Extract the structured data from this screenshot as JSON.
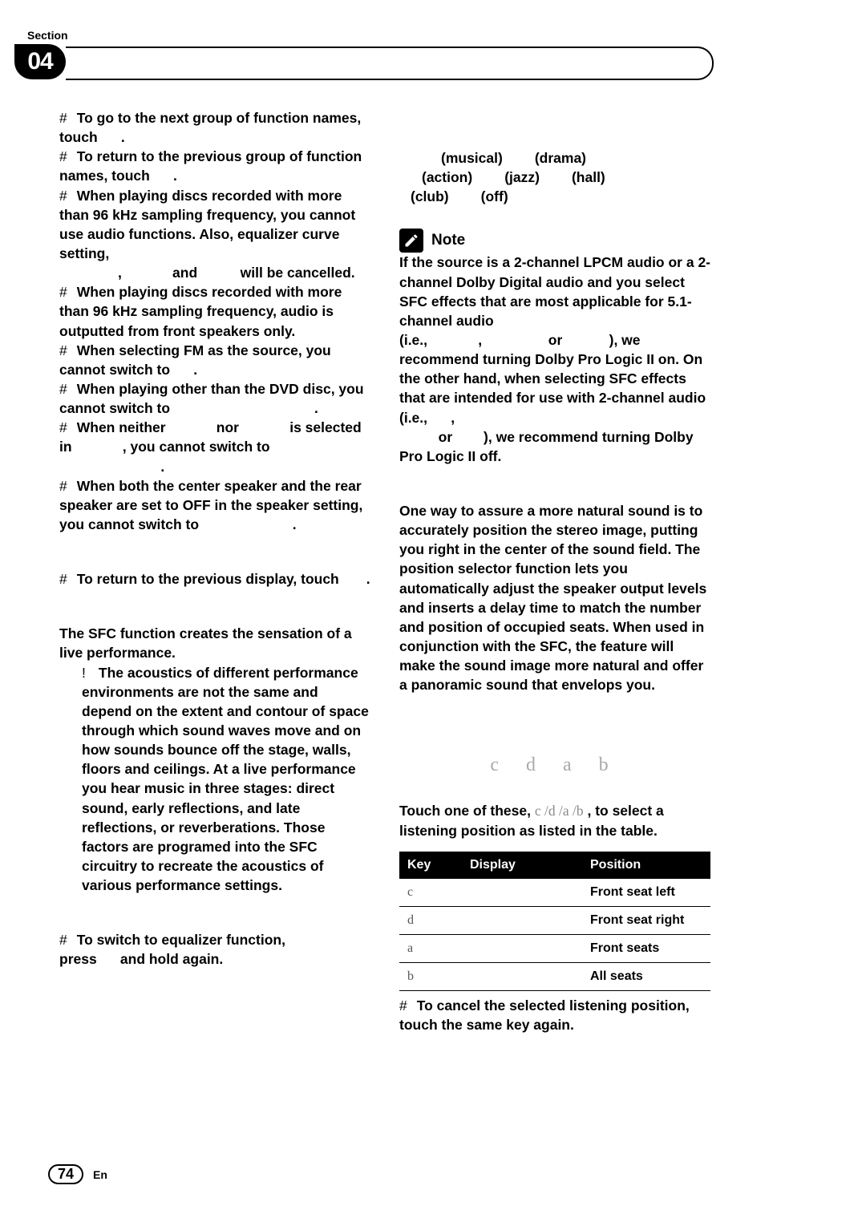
{
  "header": {
    "section_label": "Section",
    "section_number": "04"
  },
  "left": {
    "l1": "To go to the next group of function names, touch",
    "l1b": ".",
    "l2": "To return to the previous group of function names, touch",
    "l2b": ".",
    "l3": "When playing discs recorded with more than 96 kHz sampling frequency, you cannot use audio functions. Also, equalizer curve setting,",
    "l3b": ",",
    "l3c": "and",
    "l3d": "will be cancelled.",
    "l4": "When playing discs recorded with more than 96 kHz sampling frequency, audio is outputted from front speakers only.",
    "l5": "When selecting FM as the source, you cannot switch to",
    "l5b": ".",
    "l6": "When playing other than the DVD disc, you cannot switch to",
    "l6b": ".",
    "l7a": "When neither",
    "l7b": "nor",
    "l7c": "is selected in",
    "l7d": ", you cannot switch to",
    "l7e": ".",
    "l8": "When both the center speaker and the rear speaker are set to OFF in the speaker setting, you cannot switch to",
    "l8b": ".",
    "l9": "To return to the previous display, touch",
    "l9b": ".",
    "sfc_p1": "The SFC function creates the sensation of a live performance.",
    "sfc_p2": "The acoustics of different performance environments are not the same and depend on the extent and contour of space through which sound waves move and on how sounds bounce off the stage, walls, floors and ceilings. At a live performance you hear music in three stages: direct sound, early reflections, and late reflections, or reverberations. Those factors are programed into the SFC circuitry to recreate the acoustics of various performance settings.",
    "eq": "To switch to equalizer function, press",
    "eq_b": "and hold again."
  },
  "right": {
    "modes": [
      "(musical)",
      "(drama)",
      "(action)",
      "(jazz)",
      "(hall)",
      "(club)",
      "(off)"
    ],
    "note_label": "Note",
    "note_body_a": "If the source is a 2-channel LPCM audio or a 2-channel Dolby Digital audio and you select SFC effects that are most applicable for 5.1-channel audio (i.e.,",
    "note_body_b": ",",
    "note_body_c": "or",
    "note_body_d": "), we recommend turning Dolby Pro Logic II on. On the other hand, when selecting SFC effects that are intended for use with 2-channel audio (i.e.,",
    "note_body_e": ",",
    "note_body_f": "or",
    "note_body_g": "), we recommend turning Dolby Pro Logic II off.",
    "pos_p": "One way to assure a more natural sound is to accurately position the stereo image, putting you right in the center of the sound field. The position selector function lets you automatically adjust the speaker output levels and inserts a delay time to match the number and position of occupied seats. When used in conjunction with the SFC, the feature will make the sound image more natural and offer a panoramic sound that envelops you.",
    "cdab": "c d a b",
    "touch_a": "Touch one of these, ",
    "touch_keys": "c /d /a /b",
    "touch_b": " , to select a listening position as listed in the table.",
    "table": {
      "headers": [
        "Key",
        "Display",
        "Position"
      ],
      "rows": [
        {
          "k": "c",
          "d": "",
          "p": "Front seat left"
        },
        {
          "k": "d",
          "d": "",
          "p": "Front seat right"
        },
        {
          "k": "a",
          "d": "",
          "p": "Front seats"
        },
        {
          "k": "b",
          "d": "",
          "p": "All seats"
        }
      ]
    },
    "cancel": "To cancel the selected listening position, touch the same key again."
  },
  "footer": {
    "page": "74",
    "lang": "En"
  }
}
